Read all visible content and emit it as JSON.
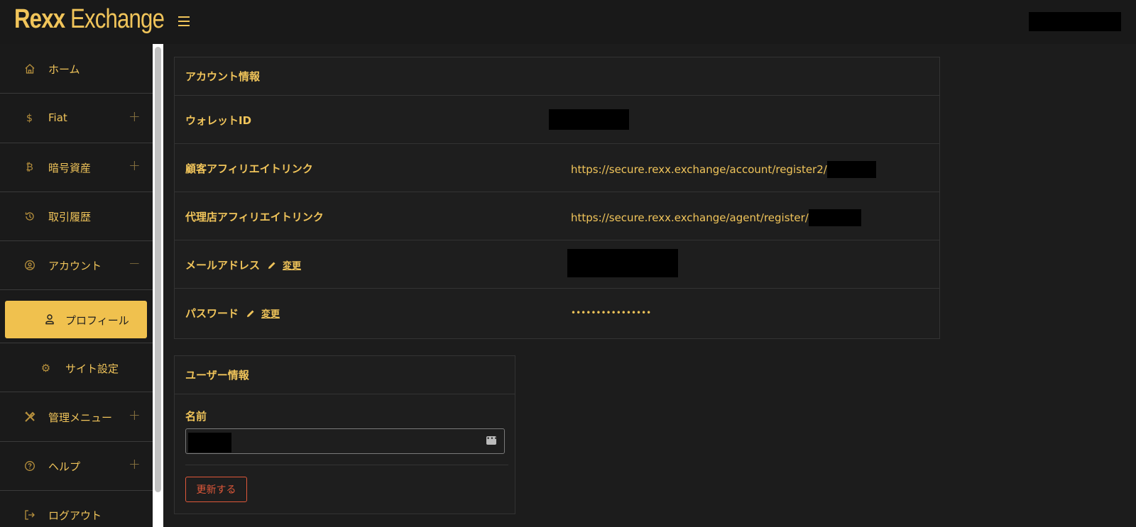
{
  "header": {
    "logo_bold": "Rexx",
    "logo_light": " Exchange"
  },
  "sidebar": {
    "items": [
      {
        "label": "ホーム",
        "icon": "home-icon"
      },
      {
        "label": "Fiat",
        "icon": "dollar-icon",
        "toggle": "+"
      },
      {
        "label": "暗号資産",
        "icon": "bitcoin-icon",
        "toggle": "+"
      },
      {
        "label": "取引履歴",
        "icon": "history-icon"
      },
      {
        "label": "アカウント",
        "icon": "user-circle-icon",
        "toggle": "−"
      },
      {
        "label": "プロフィール",
        "icon": "user-icon"
      },
      {
        "label": "サイト設定",
        "icon": "gear-icon"
      },
      {
        "label": "管理メニュー",
        "icon": "tools-icon",
        "toggle": "+"
      },
      {
        "label": "ヘルプ",
        "icon": "help-icon",
        "toggle": "+"
      },
      {
        "label": "ログアウト",
        "icon": "logout-icon"
      }
    ]
  },
  "account_card": {
    "title": "アカウント情報",
    "wallet_label": "ウォレットID",
    "customer_link_label": "顧客アフィリエイトリンク",
    "customer_link": "https://secure.rexx.exchange/account/register2/",
    "agent_link_label": "代理店アフィリエイトリンク",
    "agent_link": "https://secure.rexx.exchange/agent/register/",
    "email_label": "メールアドレス",
    "email_change": "変更",
    "password_label": "パスワード",
    "password_change": "変更",
    "password_value": "••••••••••••••••"
  },
  "user_card": {
    "title": "ユーザー情報",
    "name_label": "名前",
    "update_button": "更新する"
  },
  "colors": {
    "accent": "#f0c45a",
    "active_bg": "#f0c14e",
    "danger": "#e0583a",
    "background": "#1c1c1c"
  }
}
